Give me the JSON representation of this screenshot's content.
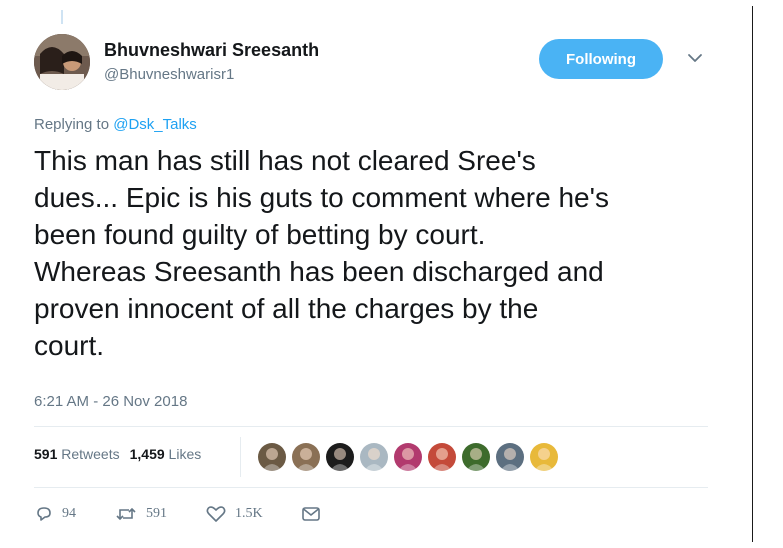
{
  "colors": {
    "accent": "#4ab3f4",
    "link": "#1da1f2",
    "muted": "#657786",
    "text": "#14171a"
  },
  "author": {
    "name": "Bhuvneshwari Sreesanth",
    "handle": "@Bhuvneshwarisr1"
  },
  "follow_button": {
    "label": "Following"
  },
  "reply_context": {
    "prefix": "Replying to ",
    "target": "@Dsk_Talks"
  },
  "tweet": {
    "lines": [
      "This man has still has not cleared Sree's",
      "dues... Epic is his guts to comment where he's",
      "been found guilty of betting by court.",
      "Whereas Sreesanth has been discharged and",
      "proven innocent of all the charges by the",
      "court."
    ],
    "timestamp": "6:21 AM - 26 Nov 2018"
  },
  "stats": {
    "retweets": "591",
    "retweets_label": "Retweets",
    "likes": "1,459",
    "likes_label": "Likes"
  },
  "likers": [
    {
      "icon": "liker-avatar-1",
      "color": "#6b5a44"
    },
    {
      "icon": "liker-avatar-2",
      "color": "#8a7055"
    },
    {
      "icon": "liker-avatar-3",
      "color": "#1c1c1c"
    },
    {
      "icon": "liker-avatar-4",
      "color": "#aab8c2"
    },
    {
      "icon": "liker-avatar-5",
      "color": "#b23a6e"
    },
    {
      "icon": "liker-avatar-6",
      "color": "#c44a3a"
    },
    {
      "icon": "liker-avatar-7",
      "color": "#3d6b2c"
    },
    {
      "icon": "liker-avatar-8",
      "color": "#5c6f80"
    },
    {
      "icon": "liker-avatar-9",
      "color": "#e8b93a"
    }
  ],
  "actions": {
    "replies": "94",
    "retweets": "591",
    "likes": "1.5K"
  }
}
